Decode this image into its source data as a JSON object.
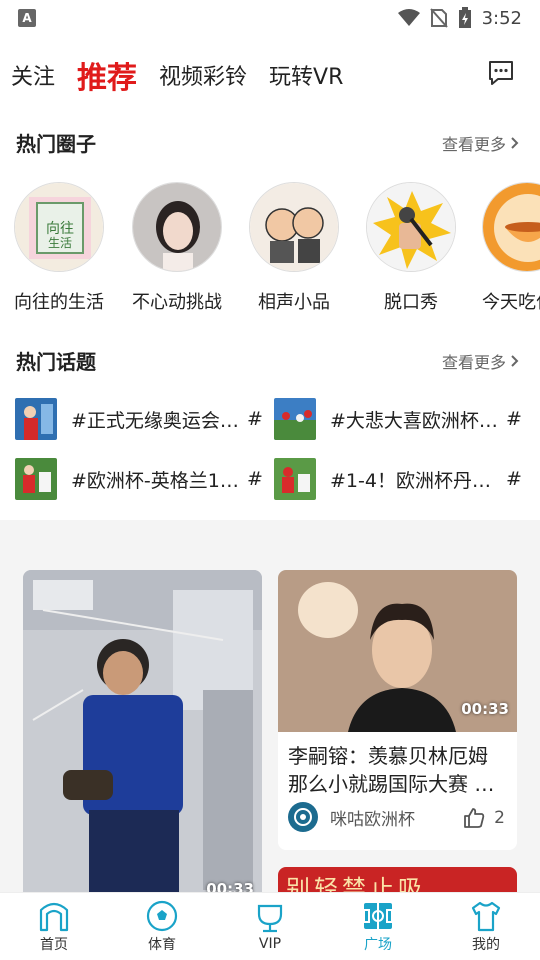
{
  "status_bar": {
    "time": "3:52",
    "notification_icon": "A"
  },
  "top_tabs": [
    {
      "label": "关注",
      "active": false
    },
    {
      "label": "推荐",
      "active": true
    },
    {
      "label": "视频彩铃",
      "active": false
    },
    {
      "label": "玩转VR",
      "active": false
    }
  ],
  "circles_section": {
    "title": "热门圈子",
    "see_more": "查看更多",
    "items": [
      {
        "label": "向往的生活",
        "icon": "xiangwang-logo"
      },
      {
        "label": "不心动挑战",
        "icon": "girl-portrait"
      },
      {
        "label": "相声小品",
        "icon": "crosstalk-cartoon"
      },
      {
        "label": "脱口秀",
        "icon": "microphone-fist"
      },
      {
        "label": "今天吃什么",
        "icon": "food-bowl"
      }
    ]
  },
  "topics_section": {
    "title": "热门话题",
    "see_more": "查看更多",
    "items": [
      {
        "text": "#正式无缘奥运会…",
        "hash": "#"
      },
      {
        "text": "#大悲大喜欧洲杯…",
        "hash": "#"
      },
      {
        "text": "#欧洲杯-英格兰1-…",
        "hash": "#"
      },
      {
        "text": "#1-4！欧洲杯丹麦…",
        "hash": "#"
      }
    ]
  },
  "feed": {
    "left_card": {
      "duration": "00:33"
    },
    "right_card": {
      "duration": "00:33",
      "title": "李嗣镕：羡慕贝林厄姆那么小就踢国际大赛 …",
      "author": "咪咕欧洲杯",
      "likes": "2"
    },
    "right_card_2": {
      "banner_text": "别轻禁止吸"
    }
  },
  "bottom_nav": [
    {
      "label": "首页",
      "icon": "home-arch-icon",
      "active": false
    },
    {
      "label": "体育",
      "icon": "football-icon",
      "active": false
    },
    {
      "label": "VIP",
      "icon": "vip-cup-icon",
      "active": false
    },
    {
      "label": "广场",
      "icon": "pitch-icon",
      "active": true
    },
    {
      "label": "我的",
      "icon": "jersey-icon",
      "active": false
    }
  ],
  "colors": {
    "accent_red": "#e01b1b",
    "accent_cyan": "#1aa3c8"
  }
}
